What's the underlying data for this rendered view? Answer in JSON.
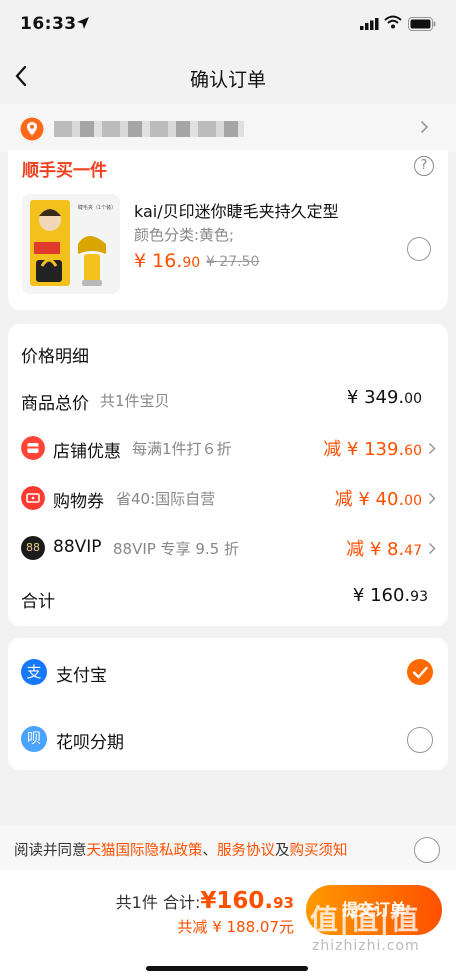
{
  "status": {
    "time": "16:33"
  },
  "nav": {
    "title": "确认订单"
  },
  "addon": {
    "title": "顺手买一件",
    "help": "?",
    "product": {
      "name": "kai/贝印迷你睫毛夹持久定型",
      "variant": "颜色分类:黄色;",
      "price_int": "¥ 16.",
      "price_dec": "90",
      "orig_price": "¥ 27.50",
      "thumb_text": "睫毛夹（1个装）"
    }
  },
  "price_detail": {
    "title": "价格明细",
    "total_goods": {
      "label": "商品总价",
      "sub": "共1件宝贝",
      "amt_int": "¥ 349.",
      "amt_dec": "00"
    },
    "shop_discount": {
      "label": "店铺优惠",
      "sub": "每满1件打６折",
      "amt_int": "减 ¥ 139.",
      "amt_dec": "60",
      "icon": "shop-icon"
    },
    "coupon": {
      "label": "购物券",
      "sub": "省40:国际自营",
      "amt_int": "减 ¥ 40.",
      "amt_dec": "00",
      "icon": "coupon-icon"
    },
    "vip": {
      "label": "88VIP",
      "sub": "88VIP 专享 9.5 折",
      "amt_int": "减 ¥ 8.",
      "amt_dec": "47",
      "icon_text": "88"
    },
    "sum": {
      "label": "合计",
      "amt_int": "¥ 160.",
      "amt_dec": "93"
    }
  },
  "payment": {
    "options": [
      {
        "label": "支付宝",
        "icon": "alipay-icon",
        "icon_text": "支",
        "selected": true
      },
      {
        "label": "花呗分期",
        "icon": "huabei-icon",
        "icon_text": "呗",
        "selected": false
      }
    ]
  },
  "agreement": {
    "prefix": "阅读并同意",
    "link1": "天猫国际隐私政策",
    "sep1": "、",
    "link2": "服务协议",
    "sep2": "及",
    "link3": "购买须知"
  },
  "footer": {
    "count": "共1件",
    "total_label": "合计:",
    "total_int": "¥160.",
    "total_dec": "93",
    "saved": "共减 ¥ 188.07元",
    "submit_label": "提交订单",
    "watermark": "值|值|值",
    "watermark_url": "zhizhizhi.com"
  },
  "colors": {
    "accent": "#ff5000",
    "addon_title": "#f0401f",
    "submit_start": "#ff9a00",
    "submit_end": "#ff5000"
  }
}
